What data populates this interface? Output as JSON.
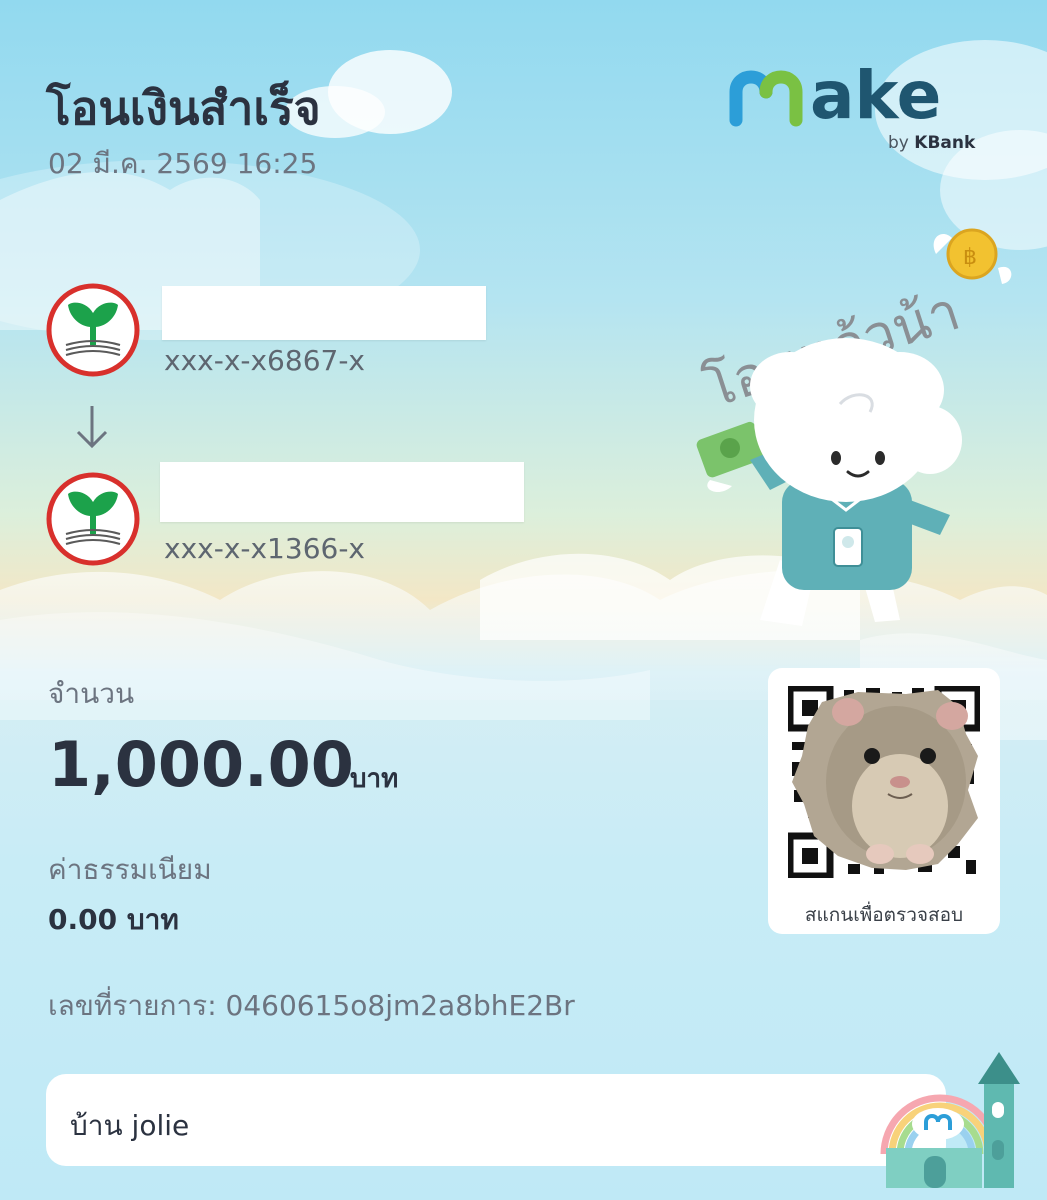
{
  "header": {
    "title": "โอนเงินสำเร็จ",
    "datetime": "02 มี.ค. 2569 16:25"
  },
  "brand": {
    "logo_text": "make",
    "by_prefix": "by",
    "by_name": "KBank"
  },
  "sender": {
    "account": "xxx-x-x6867-x",
    "bank_icon": "kbank-leaf-icon"
  },
  "recipient": {
    "account": "xxx-x-x1366-x",
    "bank_icon": "kbank-leaf-icon"
  },
  "mascot": {
    "speech": "โอนแล้วน้า"
  },
  "amount": {
    "label": "จำนวน",
    "value": "1,000.00",
    "unit": "บาท"
  },
  "fee": {
    "label": "ค่าธรรมเนียม",
    "value": "0.00 บาท"
  },
  "reference": {
    "text": "เลขที่รายการ: 0460615o8jm2a8bhE2Br"
  },
  "qr": {
    "caption": "สแกนเพื่อตรวจสอบ"
  },
  "memo": {
    "text": "บ้าน jolie"
  },
  "colors": {
    "kbank_green": "#1ca24b",
    "kbank_red": "#d8302c",
    "text_dark": "#2b3240",
    "text_gray": "#6c7480",
    "logo_blue": "#2c9ed8",
    "logo_green": "#7ac143",
    "logo_dark": "#1f5670"
  }
}
